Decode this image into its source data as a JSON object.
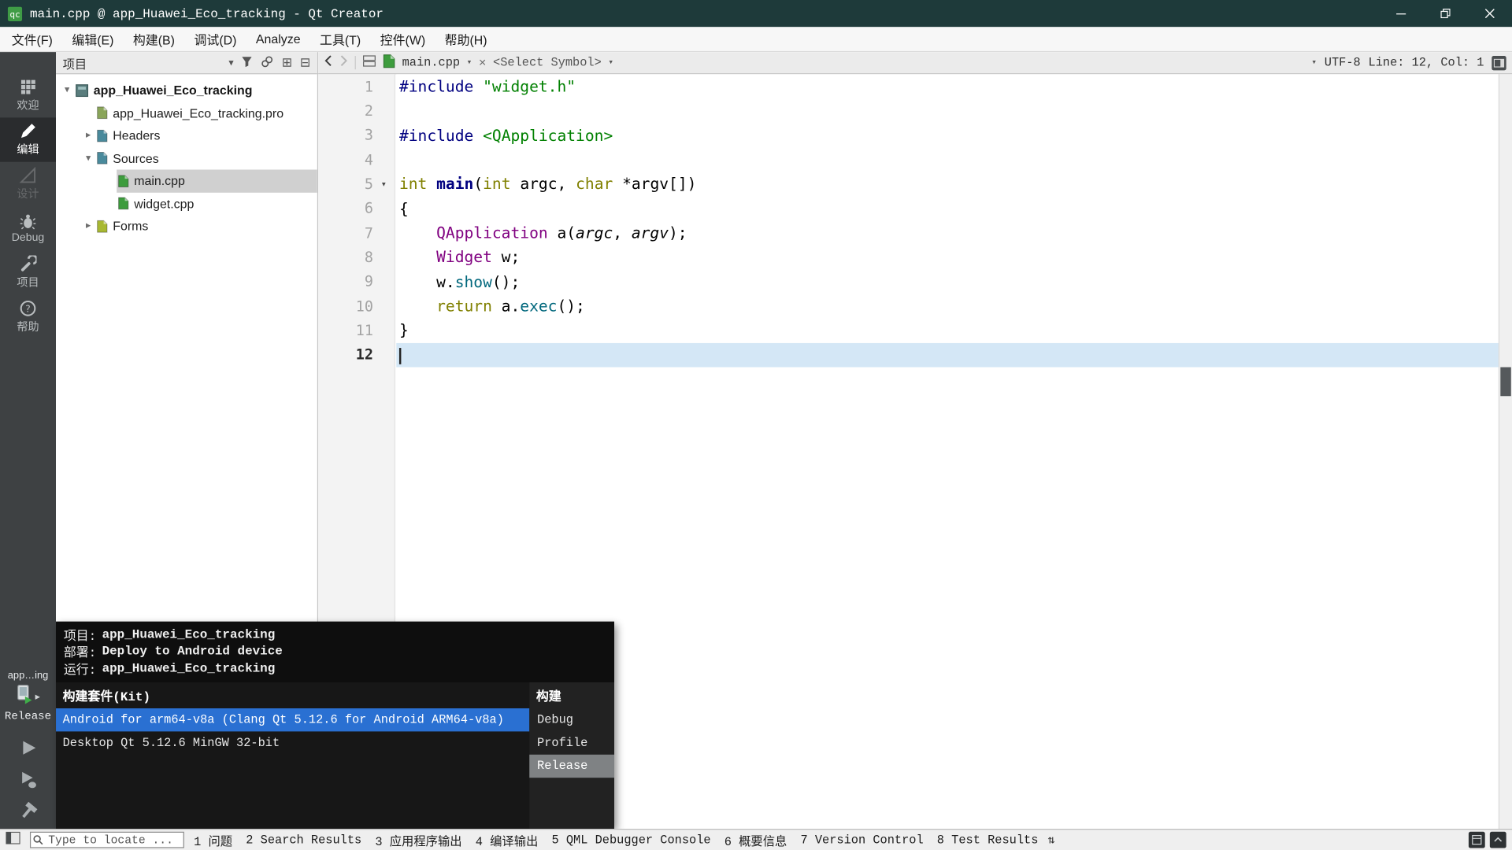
{
  "window": {
    "title": "main.cpp @ app_Huawei_Eco_tracking - Qt Creator"
  },
  "menubar": [
    {
      "id": "file",
      "label": "文件(F)"
    },
    {
      "id": "edit",
      "label": "编辑(E)"
    },
    {
      "id": "build",
      "label": "构建(B)"
    },
    {
      "id": "debug",
      "label": "调试(D)"
    },
    {
      "id": "analyze",
      "label": "Analyze"
    },
    {
      "id": "tools",
      "label": "工具(T)"
    },
    {
      "id": "window",
      "label": "控件(W)"
    },
    {
      "id": "help",
      "label": "帮助(H)"
    }
  ],
  "modes": [
    {
      "id": "welcome",
      "label": "欢迎",
      "state": "normal"
    },
    {
      "id": "edit",
      "label": "编辑",
      "state": "active"
    },
    {
      "id": "design",
      "label": "设计",
      "state": "disabled"
    },
    {
      "id": "debug",
      "label": "Debug",
      "state": "normal"
    },
    {
      "id": "projects",
      "label": "项目",
      "state": "normal"
    },
    {
      "id": "help",
      "label": "帮助",
      "state": "normal"
    }
  ],
  "target_selector": {
    "project_short": "app…ing",
    "config": "Release"
  },
  "project_panel": {
    "title": "项目",
    "tree": [
      {
        "label": "app_Huawei_Eco_tracking",
        "level": 0,
        "expand": "open",
        "icon": "project",
        "bold": true,
        "selected": false
      },
      {
        "label": "app_Huawei_Eco_tracking.pro",
        "level": 1,
        "expand": "none",
        "icon": "pro",
        "bold": false,
        "selected": false
      },
      {
        "label": "Headers",
        "level": 1,
        "expand": "closed",
        "icon": "headers",
        "bold": false,
        "selected": false
      },
      {
        "label": "Sources",
        "level": 1,
        "expand": "open",
        "icon": "sources",
        "bold": false,
        "selected": false
      },
      {
        "label": "main.cpp",
        "level": 2,
        "expand": "none",
        "icon": "cpp",
        "bold": false,
        "selected": true
      },
      {
        "label": "widget.cpp",
        "level": 2,
        "expand": "none",
        "icon": "cpp",
        "bold": false,
        "selected": false
      },
      {
        "label": "Forms",
        "level": 1,
        "expand": "closed",
        "icon": "forms",
        "bold": false,
        "selected": false
      }
    ]
  },
  "editor": {
    "toolbar": {
      "file_name": "main.cpp",
      "symbol": "<Select Symbol>",
      "encoding": "UTF-8",
      "cursor_pos": "Line: 12, Col: 1"
    },
    "current_line": 12,
    "fold_line": 5,
    "code": [
      [
        {
          "t": "#include",
          "c": "pp"
        },
        {
          "t": " "
        },
        {
          "t": "\"widget.h\"",
          "c": "str"
        }
      ],
      [],
      [
        {
          "t": "#include",
          "c": "pp"
        },
        {
          "t": " "
        },
        {
          "t": "<QApplication>",
          "c": "str"
        }
      ],
      [],
      [
        {
          "t": "int",
          "c": "kw"
        },
        {
          "t": " "
        },
        {
          "t": "main",
          "c": "fn"
        },
        {
          "t": "("
        },
        {
          "t": "int",
          "c": "kw"
        },
        {
          "t": " argc, "
        },
        {
          "t": "char",
          "c": "kw"
        },
        {
          "t": " *argv[])"
        }
      ],
      [
        {
          "t": "{"
        }
      ],
      [
        {
          "t": "    "
        },
        {
          "t": "QApplication",
          "c": "type"
        },
        {
          "t": " a("
        },
        {
          "t": "argc",
          "c": "arg"
        },
        {
          "t": ", "
        },
        {
          "t": "argv",
          "c": "arg"
        },
        {
          "t": ");"
        }
      ],
      [
        {
          "t": "    "
        },
        {
          "t": "Widget",
          "c": "type"
        },
        {
          "t": " w;"
        }
      ],
      [
        {
          "t": "    w."
        },
        {
          "t": "show",
          "c": "meth"
        },
        {
          "t": "();"
        }
      ],
      [
        {
          "t": "    "
        },
        {
          "t": "return",
          "c": "kw"
        },
        {
          "t": " a."
        },
        {
          "t": "exec",
          "c": "meth"
        },
        {
          "t": "();"
        }
      ],
      [
        {
          "t": "}"
        }
      ],
      []
    ]
  },
  "popup": {
    "info": [
      {
        "label": "项目:",
        "value": "app_Huawei_Eco_tracking"
      },
      {
        "label": "部署:",
        "value": "Deploy to Android device"
      },
      {
        "label": "运行:",
        "value": "app_Huawei_Eco_tracking"
      }
    ],
    "kit_header": "构建套件(Kit)",
    "build_header": "构建",
    "kits": [
      {
        "label": "Android for arm64-v8a (Clang Qt 5.12.6 for Android ARM64-v8a)",
        "selected": true
      },
      {
        "label": "Desktop Qt 5.12.6 MinGW 32-bit",
        "selected": false
      }
    ],
    "builds": [
      {
        "label": "Debug",
        "selected": false
      },
      {
        "label": "Profile",
        "selected": false
      },
      {
        "label": "Release",
        "selected": true
      }
    ]
  },
  "statusbar": {
    "locator_placeholder": "Type to locate ...",
    "panes": [
      {
        "id": "issues",
        "num": "1",
        "label": "问题"
      },
      {
        "id": "search-results",
        "num": "2",
        "label": "Search Results"
      },
      {
        "id": "app-output",
        "num": "3",
        "label": "应用程序输出"
      },
      {
        "id": "compile-output",
        "num": "4",
        "label": "编译输出"
      },
      {
        "id": "qml-debugger-console",
        "num": "5",
        "label": "QML Debugger Console"
      },
      {
        "id": "general-messages",
        "num": "6",
        "label": "概要信息"
      },
      {
        "id": "version-control",
        "num": "7",
        "label": "Version Control"
      },
      {
        "id": "test-results",
        "num": "8",
        "label": "Test Results"
      }
    ]
  },
  "icons": {
    "caret_down": "▾",
    "expander_open": "▾",
    "expander_closed": "▸",
    "close": "×",
    "sort": "⇅",
    "split_add": "⊞",
    "split_remove": "⊟",
    "popup_arrow": "▸"
  },
  "colors": {
    "titlebar": "#1e3a3a",
    "selection_blue": "#2a70d2",
    "current_line": "#d4e7f6",
    "build_selected_gray": "#7f8284"
  }
}
